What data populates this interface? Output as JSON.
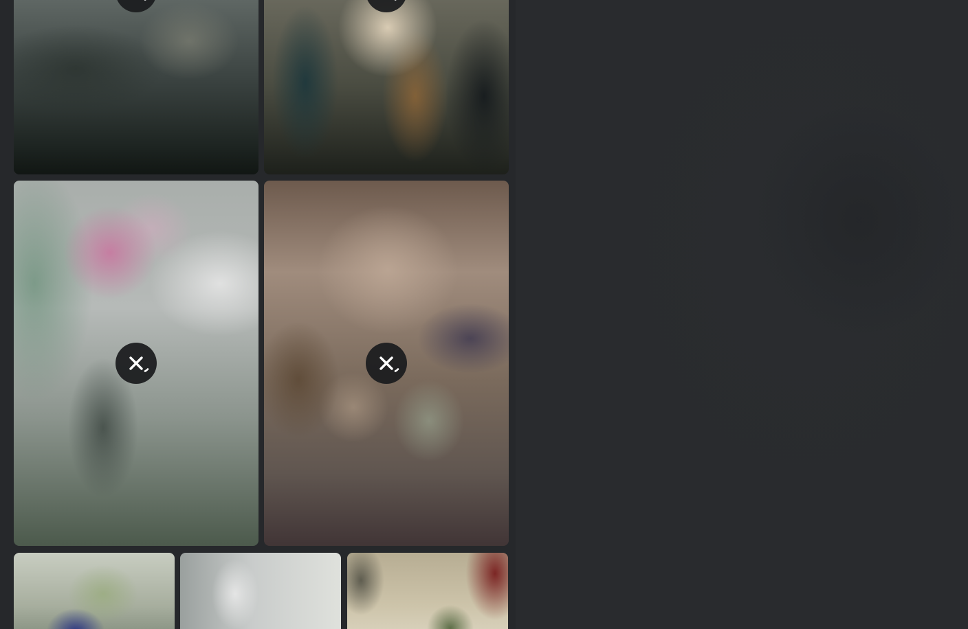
{
  "colors": {
    "page_background": "#26282b",
    "panel_background": "#292b2e",
    "button_background": "#1c1d1f",
    "icon_color": "#ffffff"
  },
  "gallery": {
    "tiles": [
      {
        "id": "tile-1",
        "content_hidden": true,
        "icon": "eye-crossed-icon"
      },
      {
        "id": "tile-2",
        "content_hidden": true,
        "icon": "eye-crossed-icon"
      },
      {
        "id": "tile-3",
        "content_hidden": true,
        "icon": "eye-crossed-icon"
      },
      {
        "id": "tile-4",
        "content_hidden": true,
        "icon": "eye-crossed-icon"
      },
      {
        "id": "tile-5",
        "content_hidden": true
      },
      {
        "id": "tile-6",
        "content_hidden": true
      },
      {
        "id": "tile-7",
        "content_hidden": true
      }
    ]
  }
}
